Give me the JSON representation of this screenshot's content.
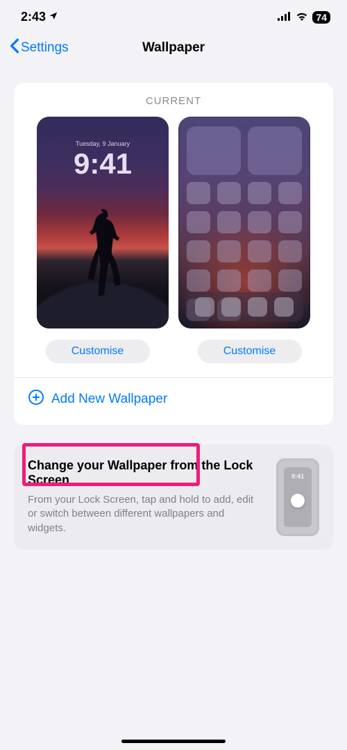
{
  "status": {
    "time": "2:43",
    "battery": "74"
  },
  "nav": {
    "back": "Settings",
    "title": "Wallpaper"
  },
  "current": {
    "label": "CURRENT",
    "lock": {
      "date": "Tuesday, 9 January",
      "time": "9:41"
    },
    "customiseLeft": "Customise",
    "customiseRight": "Customise"
  },
  "add": {
    "label": "Add New Wallpaper"
  },
  "tip": {
    "title": "Change your Wallpaper from the Lock Screen",
    "body": "From your Lock Screen, tap and hold to add, edit or switch between different wallpapers and widgets.",
    "time": "9:41"
  }
}
